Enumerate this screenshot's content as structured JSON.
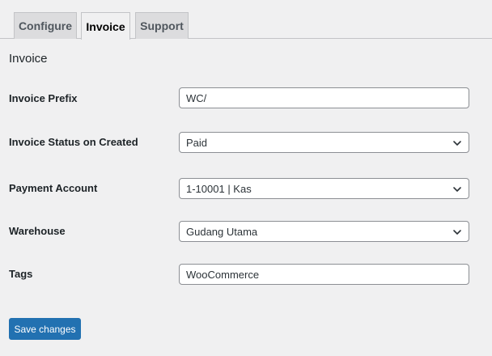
{
  "tabs": [
    {
      "label": "Configure",
      "active": false
    },
    {
      "label": "Invoice",
      "active": true
    },
    {
      "label": "Support",
      "active": false
    }
  ],
  "section": {
    "title": "Invoice"
  },
  "form": {
    "invoice_prefix": {
      "label": "Invoice Prefix",
      "value": "WC/"
    },
    "invoice_status": {
      "label": "Invoice Status on Created",
      "value": "Paid"
    },
    "payment_account": {
      "label": "Payment Account",
      "value": "1-10001 | Kas"
    },
    "warehouse": {
      "label": "Warehouse",
      "value": "Gudang Utama"
    },
    "tags": {
      "label": "Tags",
      "value": "WooCommerce"
    }
  },
  "actions": {
    "save_label": "Save changes"
  },
  "colors": {
    "accent": "#2271b1",
    "background": "#f0f0f1",
    "tab_inactive": "#dcdcde"
  },
  "icons": {
    "select_indicator": "chevron-down-icon"
  }
}
